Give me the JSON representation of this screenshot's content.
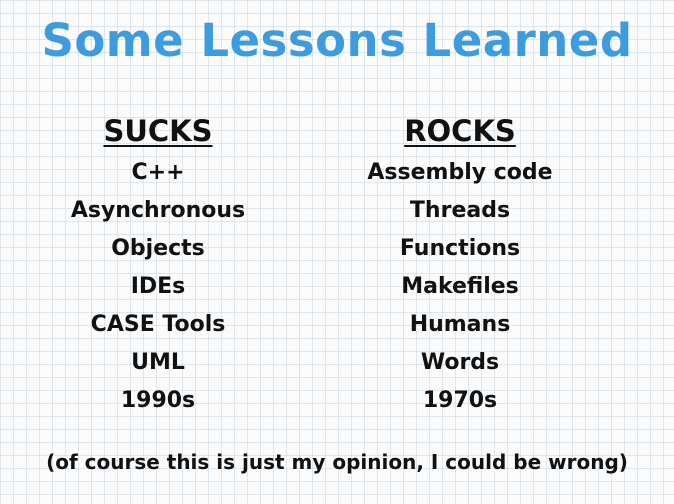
{
  "slide": {
    "title": "Some Lessons Learned",
    "left_column": {
      "header": "SUCKS",
      "items": [
        "C++",
        "Asynchronous",
        "Objects",
        "IDEs",
        "CASE Tools",
        "UML",
        "1990s"
      ]
    },
    "right_column": {
      "header": "ROCKS",
      "items": [
        "Assembly code",
        "Threads",
        "Functions",
        "Makefiles",
        "Humans",
        "Words",
        "1970s"
      ]
    },
    "footer": "(of course this is just my opinion, I could be wrong)"
  },
  "colors": {
    "title": "#3d9be0",
    "text": "#111111",
    "background": "#fbfbfb",
    "grid": "#c8d6e2"
  }
}
